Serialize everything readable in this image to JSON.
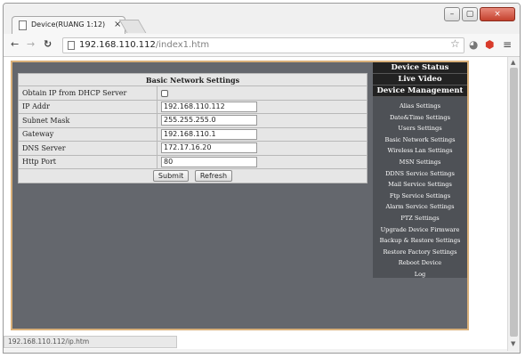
{
  "browser": {
    "tab_title": "Device(RUANG 1:12)",
    "tab_close": "×",
    "url_host": "192.168.110.112",
    "url_path": "/index1.htm",
    "status_url": "192.168.110.112/ip.htm",
    "win_min": "–",
    "win_max": "▢",
    "win_close": "×"
  },
  "settings": {
    "title": "Basic Network Settings",
    "dhcp_label": "Obtain IP from DHCP Server",
    "dhcp_checked": false,
    "fields": [
      {
        "label": "IP Addr",
        "value": "192.168.110.112"
      },
      {
        "label": "Subnet Mask",
        "value": "255.255.255.0"
      },
      {
        "label": "Gateway",
        "value": "192.168.110.1"
      },
      {
        "label": "DNS Server",
        "value": "172.17.16.20"
      },
      {
        "label": "Http Port",
        "value": "80"
      }
    ],
    "submit_label": "Submit",
    "refresh_label": "Refresh"
  },
  "menu": {
    "heads": [
      "Device Status",
      "Live Video",
      "Device Management"
    ],
    "items": [
      "Alias Settings",
      "Date&Time Settings",
      "Users Settings",
      "Basic Network Settings",
      "Wireless Lan Settings",
      "MSN Settings",
      "DDNS Service Settings",
      "Mail Service Settings",
      "Ftp Service Settings",
      "Alarm Service Settings",
      "PTZ Settings",
      "Upgrade Device Firmware",
      "Backup & Restore Settings",
      "Restore Factory Settings",
      "Reboot Device",
      "Log"
    ]
  },
  "colors": {
    "page_background": "#64676d",
    "menu_header": "#222222",
    "page_border": "#d9b07a"
  }
}
